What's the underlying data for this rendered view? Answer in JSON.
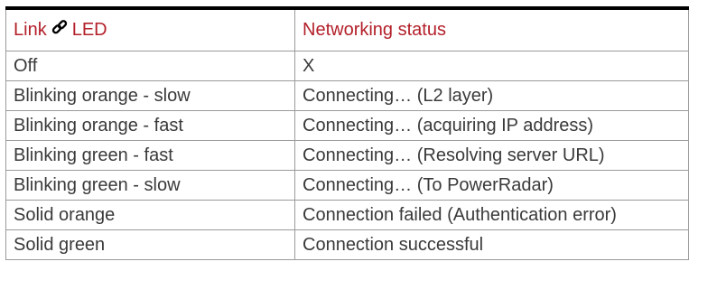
{
  "table": {
    "header": {
      "col1_prefix": "Link",
      "col1_icon": "link-icon",
      "col1_suffix": "LED",
      "col2": "Networking status"
    },
    "rows": [
      {
        "led": "Off",
        "status": "X"
      },
      {
        "led": "Blinking orange - slow",
        "status": "Connecting… (L2 layer)"
      },
      {
        "led": "Blinking orange - fast",
        "status": "Connecting… (acquiring IP address)"
      },
      {
        "led": "Blinking green - fast",
        "status": "Connecting… (Resolving server URL)"
      },
      {
        "led": "Blinking green - slow",
        "status": "Connecting… (To PowerRadar)"
      },
      {
        "led": "Solid orange",
        "status": "Connection failed (Authentication error)"
      },
      {
        "led": "Solid green",
        "status": "Connection successful"
      }
    ]
  },
  "colors": {
    "header_text": "#b3202a",
    "body_text": "#3a3a3a",
    "border": "#9a9a9a",
    "top_rule": "#000000"
  }
}
